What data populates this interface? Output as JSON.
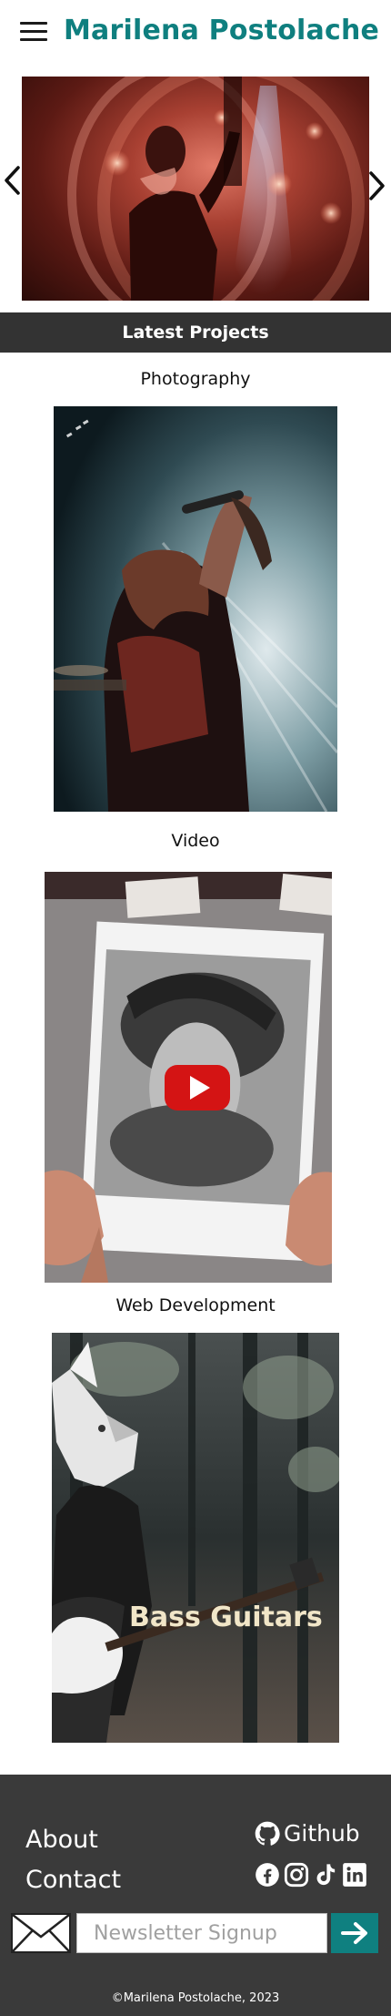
{
  "header": {
    "site_title": "Marilena Postolache",
    "menu_icon": "hamburger-menu-icon"
  },
  "carousel": {
    "prev_icon": "chevron-left-icon",
    "next_icon": "chevron-right-icon"
  },
  "latest_projects": {
    "heading": "Latest Projects",
    "items": [
      {
        "title": "Photography"
      },
      {
        "title": "Video",
        "overlay_icon": "youtube-play-icon"
      },
      {
        "title": "Web Development",
        "image_text": "Bass Guitars"
      }
    ]
  },
  "footer": {
    "links": {
      "about": "About",
      "contact": "Contact"
    },
    "github": {
      "label": "Github",
      "icon": "github-icon"
    },
    "social_icons": [
      "facebook-icon",
      "instagram-icon",
      "tiktok-icon",
      "linkedin-icon"
    ],
    "newsletter": {
      "placeholder": "Newsletter Signup",
      "icon": "envelope-icon",
      "submit_icon": "arrow-right-icon"
    },
    "copyright": "©Marilena Postolache, 2023"
  },
  "colors": {
    "brand": "#0f7f7f",
    "section_bar": "#333333",
    "footer_bg": "#3a3a3a",
    "submit_bg": "#0f8080"
  }
}
